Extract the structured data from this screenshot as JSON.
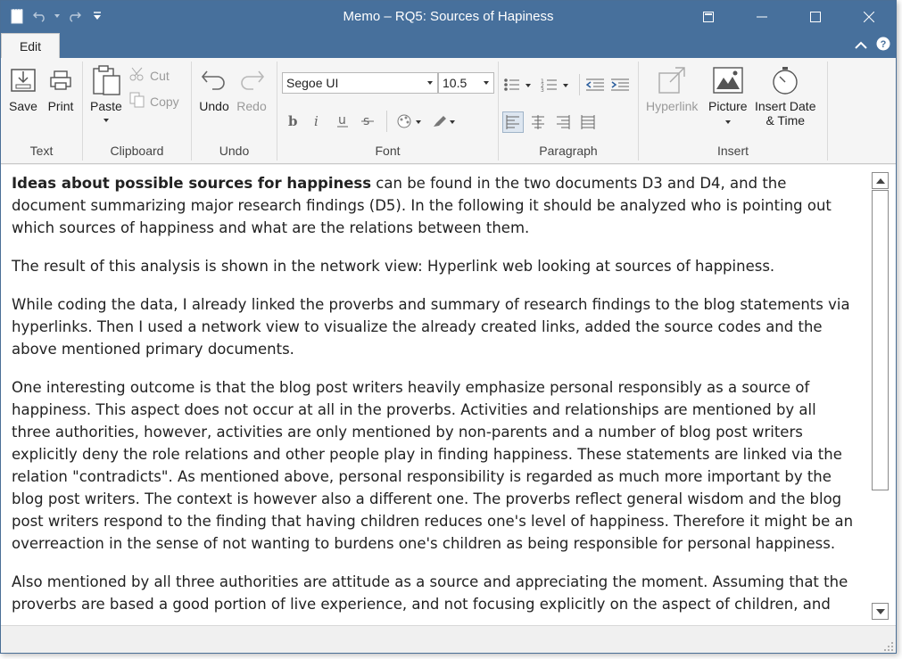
{
  "window": {
    "title": "Memo – RQ5: Sources of Hapiness",
    "colors": {
      "titlebar": "#47709c",
      "ribbon": "#f5f5f5"
    }
  },
  "quick_access": [
    "memo-icon",
    "undo-icon",
    "redo-icon",
    "customize-icon"
  ],
  "tabs": {
    "edit_label": "Edit"
  },
  "ribbon": {
    "text_group": {
      "label": "Text",
      "save": "Save",
      "print": "Print"
    },
    "clipboard_group": {
      "label": "Clipboard",
      "paste": "Paste",
      "cut": "Cut",
      "copy": "Copy"
    },
    "undo_group": {
      "label": "Undo",
      "undo": "Undo",
      "redo": "Redo"
    },
    "font_group": {
      "label": "Font",
      "font_name": "Segoe UI",
      "font_size": "10.5"
    },
    "paragraph_group": {
      "label": "Paragraph"
    },
    "insert_group": {
      "label": "Insert",
      "hyperlink": "Hyperlink",
      "picture": "Picture",
      "date_time_1": "Insert Date",
      "date_time_2": "& Time"
    }
  },
  "document": {
    "p1_bold": "Ideas about possible sources for happiness",
    "p1_rest": " can be found in the two documents D3 and D4, and the document summarizing major research findings (D5). In the following it should be analyzed who is pointing out which sources of happiness and what are the relations between them.",
    "p2": "The result of this analysis is shown in the network view: Hyperlink web looking at sources of happiness.",
    "p3": "While coding the data, I already linked the proverbs and summary of research findings to the blog statements via hyperlinks. Then I used a network view to visualize the already created links, added the source codes and the above mentioned primary documents.",
    "p4": "One interesting outcome is that the blog post writers heavily emphasize personal responsibly as a source of happiness. This aspect does not occur at all in the proverbs. Activities and relationships are mentioned by all three authorities, however, activities are only mentioned by non-parents and a number of blog post writers explicitly deny the role relations and other people play in finding happiness. These statements are linked via the relation \"contradicts\".  As mentioned above, personal responsibility is regarded as much more important by the blog post writers. The context is however also a different one. The proverbs reflect general wisdom and the blog post writers respond to the finding that having children reduces one's level of happiness. Therefore it might be an overreaction in the sense of not wanting to burdens one's children as being responsible for personal happiness.",
    "p5": "Also mentioned by all three authorities are attitude as a source and appreciating the moment. Assuming that the proverbs are based a good portion of live experience, and not focusing explicitly on the aspect of children, and"
  }
}
